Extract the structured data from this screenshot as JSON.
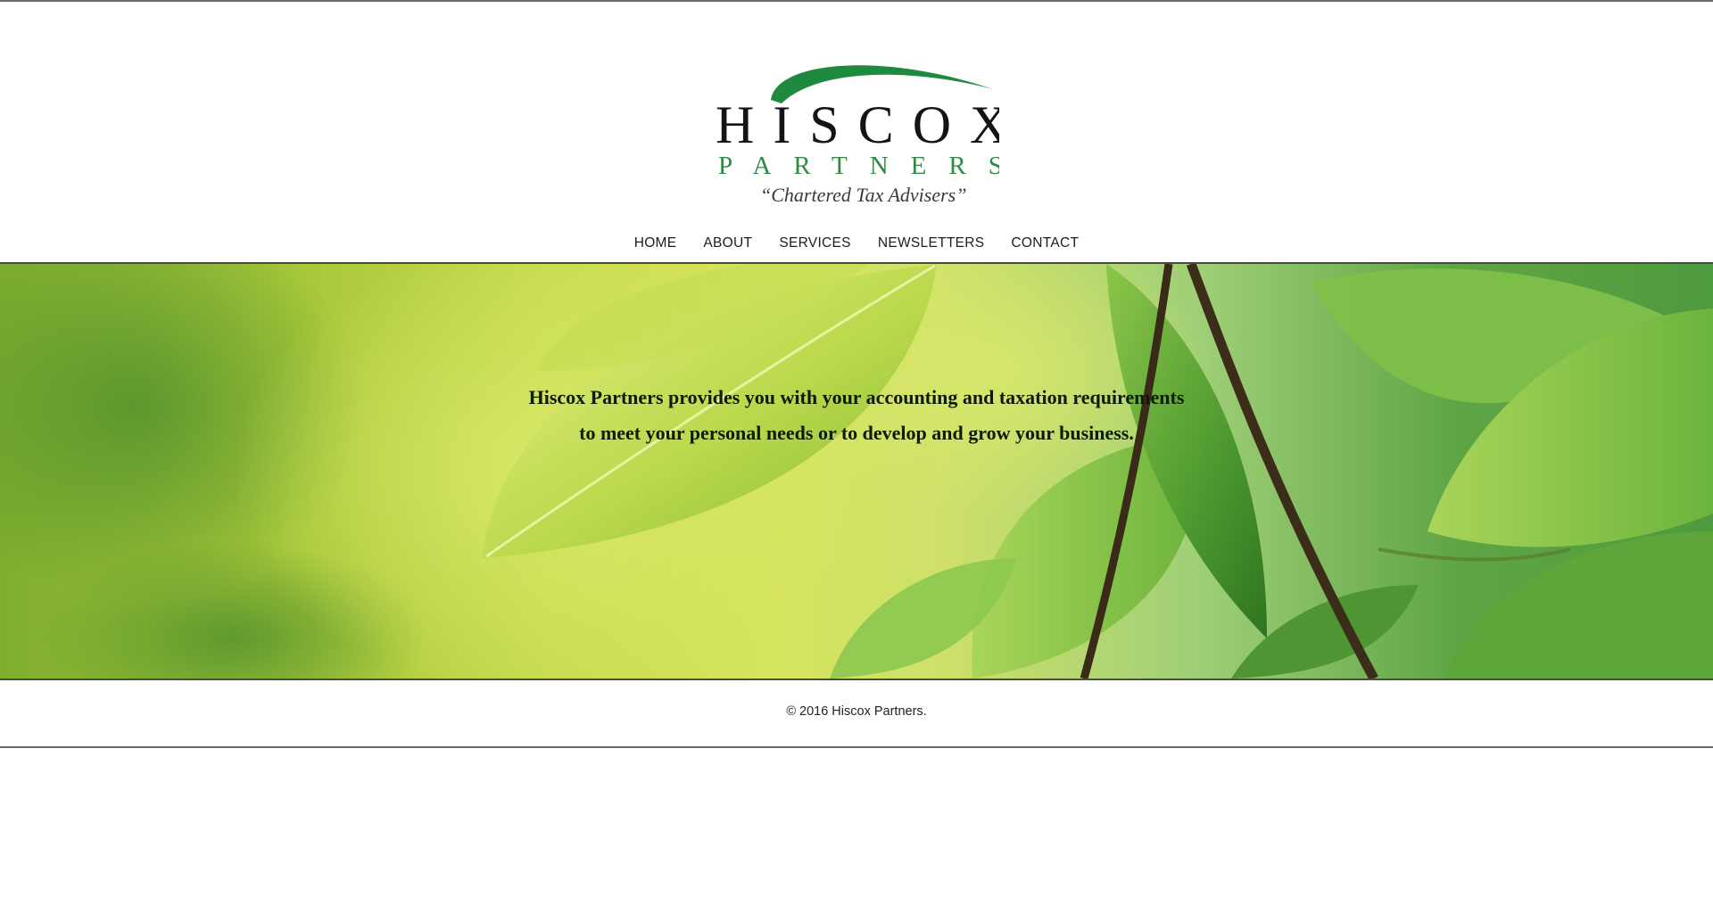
{
  "logo": {
    "name": "HISCOX",
    "subname": "PARTNERS",
    "tagline": "“Chartered Tax Advisers”",
    "colors": {
      "swoosh": "#1e8a3e",
      "name": "#141414",
      "subname": "#2f8a47"
    }
  },
  "nav": {
    "items": [
      {
        "label": "HOME"
      },
      {
        "label": "ABOUT"
      },
      {
        "label": "SERVICES"
      },
      {
        "label": "NEWSLETTERS"
      },
      {
        "label": "CONTACT"
      }
    ]
  },
  "hero": {
    "line1": "Hiscox Partners provides you with your accounting and taxation requirements",
    "line2": "to meet your personal needs or to develop and grow your business.",
    "image": "green-leaves-background"
  },
  "footer": {
    "copyright": "© 2016 Hiscox Partners."
  }
}
